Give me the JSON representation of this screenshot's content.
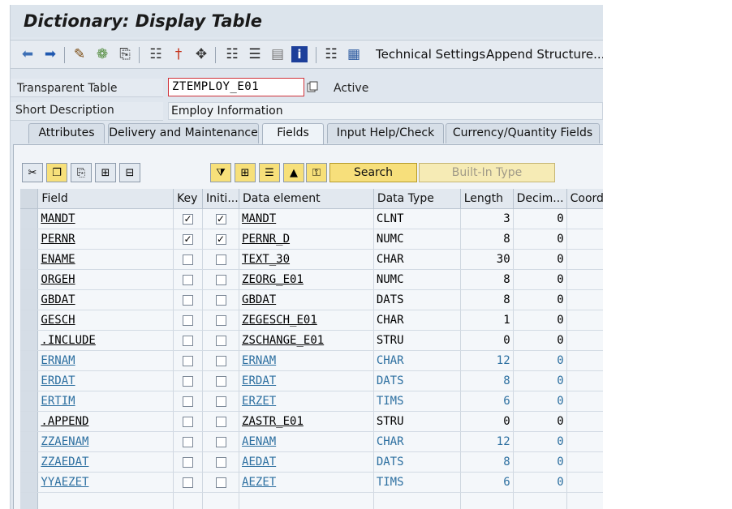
{
  "window": {
    "title": "Dictionary: Display Table"
  },
  "toolbar": {
    "icons": [
      "back-arrow-icon",
      "forward-arrow-icon",
      "display-change-icon",
      "check-icon",
      "activate-icon",
      "where-used-icon",
      "object-list-icon",
      "navigate-icon",
      "hierarchy-icon",
      "other-object-icon",
      "display-object-list-icon",
      "info-icon",
      "columns-icon",
      "layout-icon"
    ],
    "technical_settings": "Technical Settings",
    "append_structure": "Append Structure..."
  },
  "header": {
    "table_type_label": "Transparent Table",
    "table_name": "ZTEMPLOY_E01",
    "status": "Active",
    "short_desc_label": "Short Description",
    "short_desc": "Employ Information"
  },
  "tabs": [
    {
      "label": "Attributes"
    },
    {
      "label": "Delivery and Maintenance"
    },
    {
      "label": "Fields"
    },
    {
      "label": "Input Help/Check"
    },
    {
      "label": "Currency/Quantity Fields"
    }
  ],
  "active_tab": "Fields",
  "table_toolbar": {
    "search_label": "Search",
    "builtin_label": "Built-In Type"
  },
  "columns": [
    "Field",
    "Key",
    "Initi...",
    "Data element",
    "Data Type",
    "Length",
    "Decim...",
    "Coord"
  ],
  "rows": [
    {
      "field": "MANDT",
      "key": true,
      "init": true,
      "element": "MANDT",
      "type": "CLNT",
      "length": "3",
      "decimals": "0",
      "style": "normal"
    },
    {
      "field": "PERNR",
      "key": true,
      "init": true,
      "element": "PERNR_D",
      "type": "NUMC",
      "length": "8",
      "decimals": "0",
      "style": "normal"
    },
    {
      "field": "ENAME",
      "key": false,
      "init": false,
      "element": "TEXT_30",
      "type": "CHAR",
      "length": "30",
      "decimals": "0",
      "style": "normal"
    },
    {
      "field": "ORGEH",
      "key": false,
      "init": false,
      "element": "ZEORG_E01",
      "type": "NUMC",
      "length": "8",
      "decimals": "0",
      "style": "normal"
    },
    {
      "field": "GBDAT",
      "key": false,
      "init": false,
      "element": "GBDAT",
      "type": "DATS",
      "length": "8",
      "decimals": "0",
      "style": "normal"
    },
    {
      "field": "GESCH",
      "key": false,
      "init": false,
      "element": "ZEGESCH_E01",
      "type": "CHAR",
      "length": "1",
      "decimals": "0",
      "style": "normal"
    },
    {
      "field": ".INCLUDE",
      "key": false,
      "init": false,
      "element": "ZSCHANGE_E01",
      "type": "STRU",
      "length": "0",
      "decimals": "0",
      "style": "normal"
    },
    {
      "field": "ERNAM",
      "key": false,
      "init": false,
      "element": "ERNAM",
      "type": "CHAR",
      "length": "12",
      "decimals": "0",
      "style": "blue"
    },
    {
      "field": "ERDAT",
      "key": false,
      "init": false,
      "element": "ERDAT",
      "type": "DATS",
      "length": "8",
      "decimals": "0",
      "style": "blue"
    },
    {
      "field": "ERTIM",
      "key": false,
      "init": false,
      "element": "ERZET",
      "type": "TIMS",
      "length": "6",
      "decimals": "0",
      "style": "blue"
    },
    {
      "field": ".APPEND",
      "key": false,
      "init": false,
      "element": "ZASTR_E01",
      "type": "STRU",
      "length": "0",
      "decimals": "0",
      "style": "normal"
    },
    {
      "field": "ZZAENAM",
      "key": false,
      "init": false,
      "element": "AENAM",
      "type": "CHAR",
      "length": "12",
      "decimals": "0",
      "style": "blue"
    },
    {
      "field": "ZZAEDAT",
      "key": false,
      "init": false,
      "element": "AEDAT",
      "type": "DATS",
      "length": "8",
      "decimals": "0",
      "style": "blue"
    },
    {
      "field": "YYAEZET",
      "key": false,
      "init": false,
      "element": "AEZET",
      "type": "TIMS",
      "length": "6",
      "decimals": "0",
      "style": "blue"
    }
  ],
  "colors": {
    "accent_blue": "#2c6fa0",
    "search_yellow": "#f7df7b",
    "required_red": "#d0323a"
  }
}
